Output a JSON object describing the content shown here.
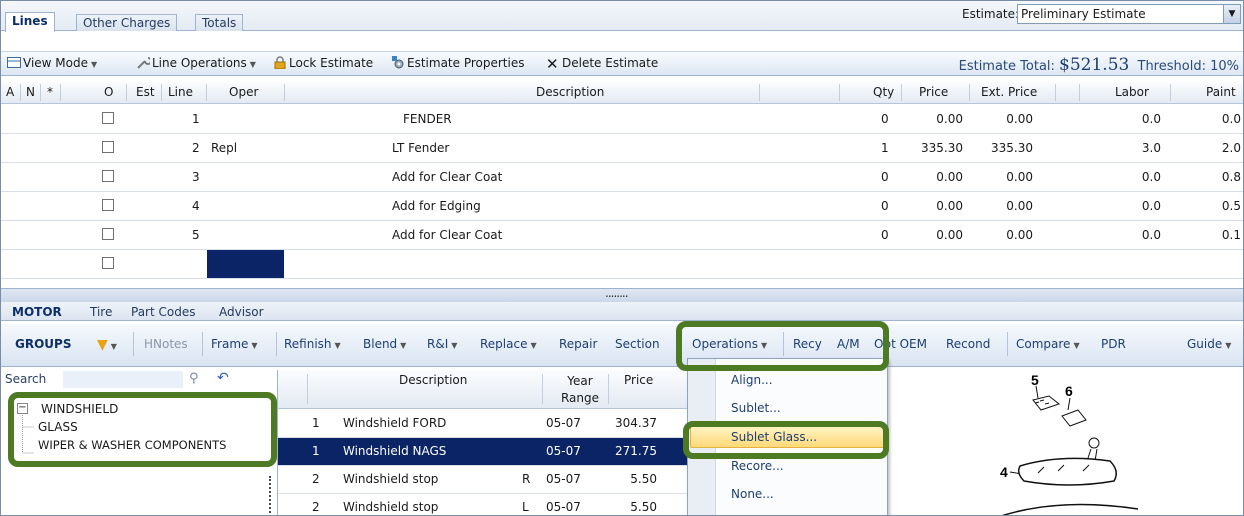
{
  "top_tabs": [
    "Lines",
    "Other Charges",
    "Totals"
  ],
  "estimate": {
    "label": "Estimate:",
    "value": "Preliminary Estimate"
  },
  "toolbar": {
    "view_mode": "View Mode",
    "line_operations": "Line Operations",
    "lock_estimate": "Lock Estimate",
    "estimate_properties": "Estimate Properties",
    "delete_estimate": "Delete Estimate",
    "estimate_total_label": "Estimate Total:",
    "estimate_total_value": "$521.53",
    "threshold_label": "Threshold:",
    "threshold_value": "10%"
  },
  "grid": {
    "columns": [
      "A",
      "N",
      "*",
      "O",
      "Est",
      "Line",
      "Oper",
      "Description",
      "Qty",
      "Price",
      "Ext. Price",
      "Labor",
      "Paint"
    ],
    "rows": [
      {
        "line": "1",
        "oper": "",
        "description": "FENDER",
        "qty": "0",
        "price": "0.00",
        "ext": "0.00",
        "labor": "0.0",
        "paint": "0.0"
      },
      {
        "line": "2",
        "oper": "Repl",
        "description": "LT Fender",
        "qty": "1",
        "price": "335.30",
        "ext": "335.30",
        "labor": "3.0",
        "paint": "2.0"
      },
      {
        "line": "3",
        "oper": "",
        "description": "Add for Clear Coat",
        "qty": "0",
        "price": "0.00",
        "ext": "0.00",
        "labor": "0.0",
        "paint": "0.8"
      },
      {
        "line": "4",
        "oper": "",
        "description": "Add for Edging",
        "qty": "0",
        "price": "0.00",
        "ext": "0.00",
        "labor": "0.0",
        "paint": "0.5"
      },
      {
        "line": "5",
        "oper": "",
        "description": "Add for Clear Coat",
        "qty": "0",
        "price": "0.00",
        "ext": "0.00",
        "labor": "0.0",
        "paint": "0.1"
      }
    ]
  },
  "splitter": "........",
  "bottom_tabs": [
    "MOTOR",
    "Tire",
    "Part Codes",
    "Advisor"
  ],
  "groups_bar": {
    "groups": "GROUPS",
    "hnotes": "HNotes",
    "frame": "Frame",
    "refinish": "Refinish",
    "blend": "Blend",
    "rni": "R&I",
    "replace": "Replace",
    "repair": "Repair",
    "section": "Section",
    "operations": "Operations",
    "recy": "Recy",
    "am": "A/M",
    "opt_oem": "Opt OEM",
    "recond": "Recond",
    "compare": "Compare",
    "pdr": "PDR",
    "guide": "Guide"
  },
  "search": {
    "label": "Search"
  },
  "tree": {
    "root": "WINDSHIELD",
    "children": [
      "GLASS",
      "WIPER & WASHER COMPONENTS"
    ]
  },
  "parts": {
    "columns": [
      "Description",
      "Year Range",
      "Price"
    ],
    "rows": [
      {
        "qty": "1",
        "description": "Windshield FORD",
        "side": "",
        "year": "05-07",
        "price": "304.37"
      },
      {
        "qty": "1",
        "description": "Windshield NAGS",
        "side": "",
        "year": "05-07",
        "price": "271.75"
      },
      {
        "qty": "2",
        "description": "Windshield stop",
        "side": "R",
        "year": "05-07",
        "price": "5.50"
      },
      {
        "qty": "2",
        "description": "Windshield stop",
        "side": "L",
        "year": "05-07",
        "price": "5.50"
      }
    ]
  },
  "operations_menu": [
    "Align...",
    "Sublet...",
    "Sublet Glass...",
    "Recore...",
    "None..."
  ],
  "diagram_callouts": [
    "5",
    "6",
    "4"
  ],
  "colors": {
    "highlight_border": "#4e7a23",
    "selection": "#0a2466",
    "menu_highlight": "#ffd978"
  }
}
